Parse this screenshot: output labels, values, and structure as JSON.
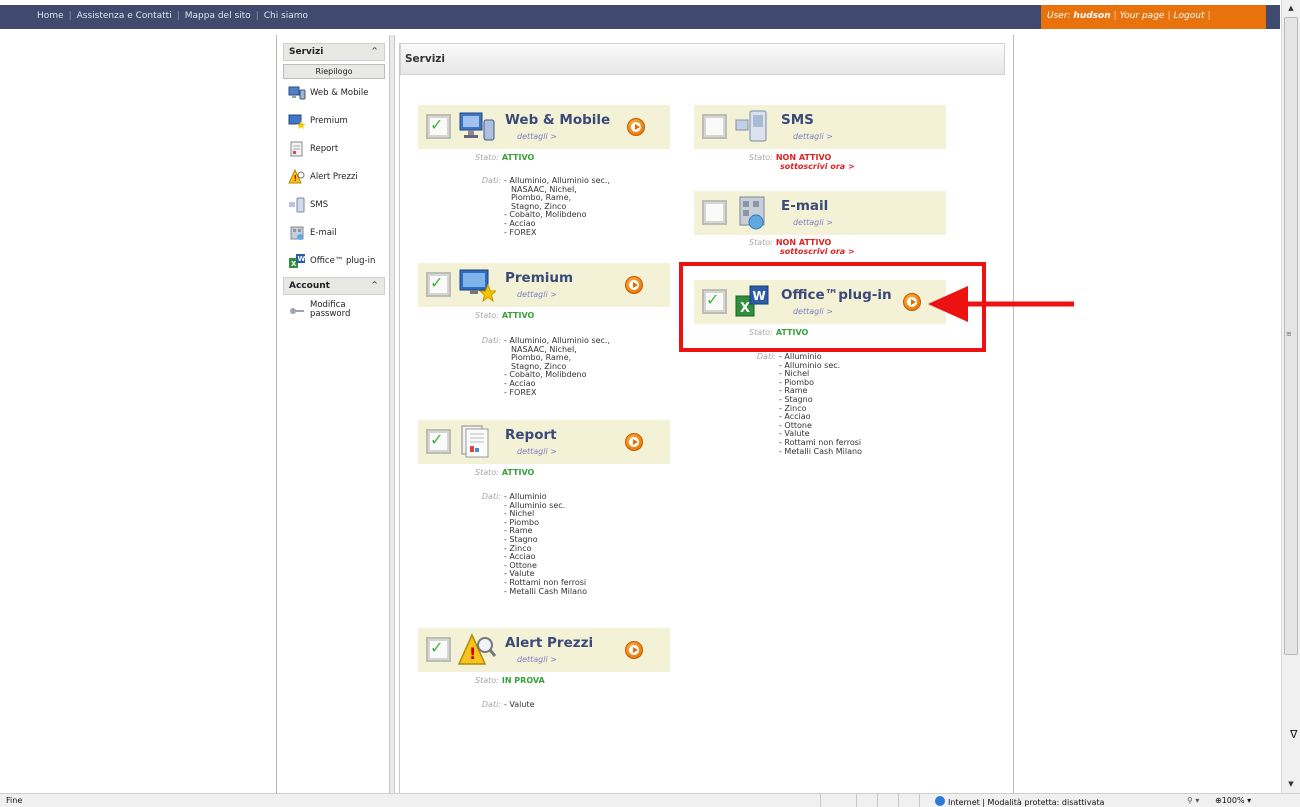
{
  "topnav": {
    "items": [
      "Home",
      "Assistenza e Contatti",
      "Mappa del sito",
      "Chi siamo"
    ],
    "separator": "|"
  },
  "userbox": {
    "user_label": "User:",
    "username": "hudson",
    "your_page": "Your page",
    "logout": "Logout"
  },
  "sidebar": {
    "servizi_header": "Servizi",
    "riepilogo": "Riepilogo",
    "items": [
      "Web & Mobile",
      "Premium",
      "Report",
      "Alert Prezzi",
      "SMS",
      "E-mail",
      "Office™ plug-in"
    ],
    "account_header": "Account",
    "account_items": [
      "Modifica password"
    ]
  },
  "main": {
    "title": "Servizi",
    "stato_label": "Stato:",
    "dati_label": "Dati:",
    "dettagli": "dettagli >",
    "subscribe_link": "sottoscrivi ora >",
    "services": {
      "web_mobile": {
        "title": "Web & Mobile",
        "stato": "ATTIVO",
        "dati": [
          "- Alluminio, Alluminio sec.,",
          "NASAAC, Nichel,",
          "Piombo, Rame,",
          "Stagno, Zinco",
          "- Cobalto, Molibdeno",
          "- Acciao",
          "- FOREX"
        ]
      },
      "premium": {
        "title": "Premium",
        "stato": "ATTIVO",
        "dati": [
          "- Alluminio, Alluminio sec.,",
          "NASAAC, Nichel,",
          "Piombo, Rame,",
          "Stagno, Zinco",
          "- Cobalto, Molibdeno",
          "- Acciao",
          "- FOREX"
        ]
      },
      "report": {
        "title": "Report",
        "stato": "ATTIVO",
        "dati": [
          "- Alluminio",
          "- Alluminio sec.",
          "- Nichel",
          "- Piombo",
          "- Rame",
          "- Stagno",
          "- Zinco",
          "- Acciao",
          "- Ottone",
          "- Valute",
          "- Rottami non ferrosi",
          "- Metalli Cash Milano"
        ]
      },
      "alert_prezzi": {
        "title": "Alert Prezzi",
        "stato": "IN PROVA",
        "dati": [
          "- Valute"
        ]
      },
      "sms": {
        "title": "SMS",
        "stato": "NON ATTIVO"
      },
      "email": {
        "title": "E-mail",
        "stato": "NON ATTIVO"
      },
      "office": {
        "title": "Office™plug-in",
        "stato": "ATTIVO",
        "dati": [
          "- Alluminio",
          "- Alluminio sec.",
          "- Nichel",
          "- Piombo",
          "- Rame",
          "- Stagno",
          "- Zinco",
          "- Acciao",
          "- Ottone",
          "- Valute",
          "- Rottami non ferrosi",
          "- Metalli Cash Milano"
        ]
      }
    }
  },
  "statusbar": {
    "status": "Fine",
    "zone": "Internet | Modalità protetta: disattivata",
    "zoom": "100%"
  },
  "colors": {
    "topbar": "#3f4a6e",
    "userbox": "#e8720c",
    "card": "#f3f1d6",
    "title": "#3a4a78",
    "active": "#3aa03a",
    "inactive": "#e02020",
    "highlight": "#ee1111"
  }
}
